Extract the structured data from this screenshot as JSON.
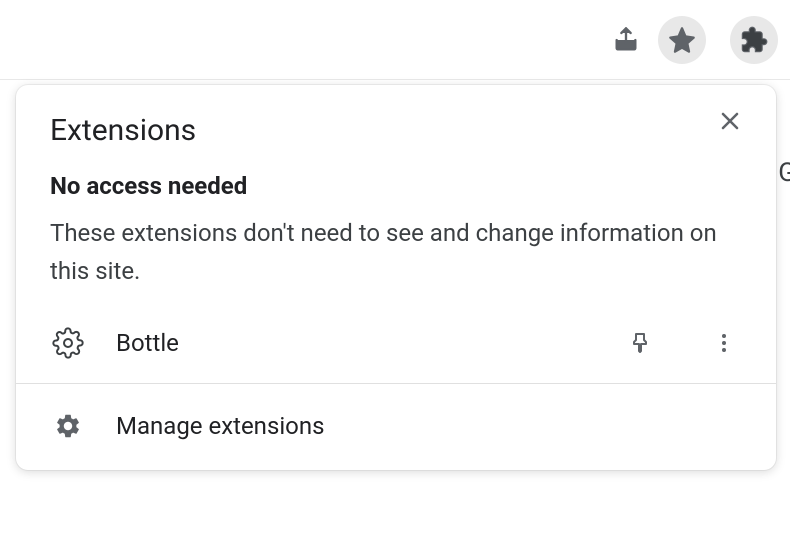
{
  "popup": {
    "title": "Extensions",
    "section": {
      "heading": "No access needed",
      "description": "These extensions don't need to see and change information on this site."
    },
    "extensions": [
      {
        "name": "Bottle"
      }
    ],
    "footer": {
      "label": "Manage extensions"
    }
  },
  "background_letter": "G"
}
